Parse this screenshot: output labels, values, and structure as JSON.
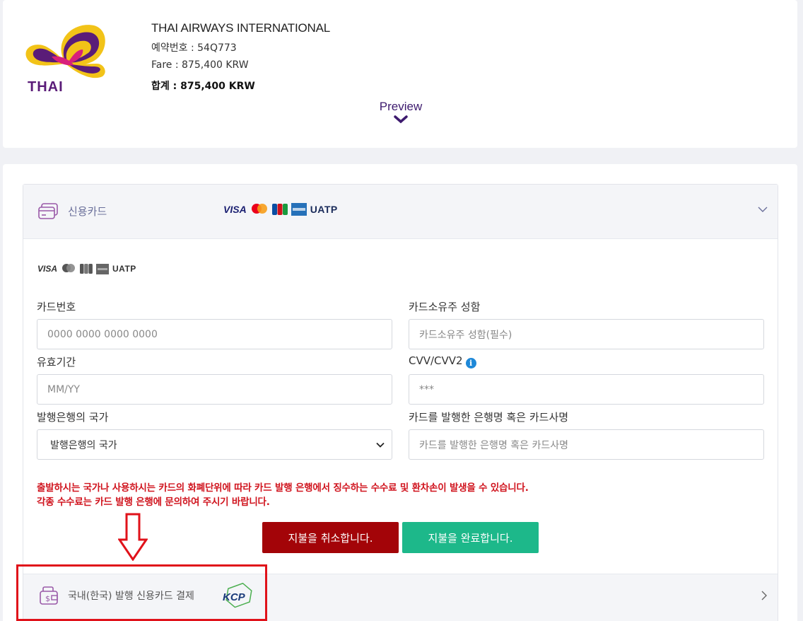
{
  "header": {
    "airline_name": "THAI AIRWAYS INTERNATIONAL",
    "logo_text": "THAI",
    "booking_ref": "예약번호 : 54Q773",
    "fare": "Fare : 875,400 KRW",
    "total": "합계 : 875,400 KRW",
    "preview_label": "Preview"
  },
  "credit_card_section": {
    "title": "신용카드",
    "card_brands": [
      "VISA",
      "Mastercard",
      "JCB",
      "AMEX",
      "UATP"
    ],
    "fields": {
      "card_number": {
        "label": "카드번호",
        "placeholder": "0000 0000 0000 0000"
      },
      "holder_name": {
        "label": "카드소유주 성함",
        "placeholder": "카드소유주 성함(필수)"
      },
      "expiry": {
        "label": "유효기간",
        "placeholder": "MM/YY"
      },
      "cvv": {
        "label": "CVV/CVV2",
        "placeholder": "***"
      },
      "issuer_country": {
        "label": "발행은행의 국가",
        "selected": "발행은행의 국가"
      },
      "issuer_bank": {
        "label": "카드를 발행한 은행명 혹은 카드사명",
        "placeholder": "카드를 발행한 은행명 혹은 카드사명"
      }
    },
    "warning_line1": "출발하시는 국가나 사용하시는 카드의 화폐단위에 따라 카드 발행 은행에서 징수하는 수수료 및 환차손이 발생을 수 있습니다.",
    "warning_line2": "각종 수수료는 카드 발행 은행에 문의하여 주시기 바랍니다.",
    "cancel_button": "지불을 취소합니다.",
    "complete_button": "지불을 완료합니다."
  },
  "domestic_section": {
    "title": "국내(한국) 발행 신용카드 결제",
    "provider_logo": "KCP"
  },
  "colors": {
    "brand_purple": "#3d1a6e",
    "cancel_red": "#a30408",
    "complete_green": "#1db88a",
    "warning_red": "#d0141e",
    "annotation_red": "#e0121a"
  }
}
